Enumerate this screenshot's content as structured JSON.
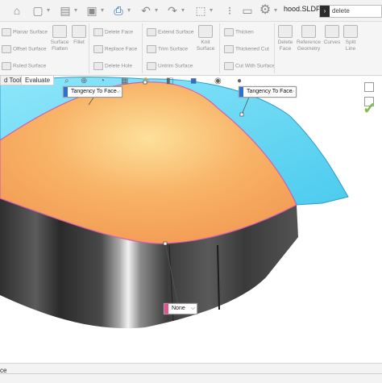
{
  "titlebar": {
    "document_title": "hood.SLDP...",
    "search_value": "delete",
    "icons": [
      "home-icon",
      "new-document-icon",
      "open-folder-icon",
      "save-icon",
      "print-icon",
      "undo-icon",
      "redo-icon",
      "select-icon",
      "traffic-light-icon",
      "options-gear-icon"
    ]
  },
  "ribbon": {
    "col1": [
      "Planar Surface",
      "Offset Surface",
      "Ruled Surface"
    ],
    "col1b": [
      "Surface Flatten"
    ],
    "col1c": [
      "Fillet"
    ],
    "col2": [
      "Delete Face",
      "Replace Face",
      "Delete Hole"
    ],
    "col3": [
      "Extend Surface",
      "Trim Surface",
      "Untrim Surface"
    ],
    "col3b": [
      "Knit Surface"
    ],
    "col4": [
      "Thicken",
      "Thickened Cut",
      "Cut With Surface"
    ],
    "col5": [
      "Delete Face",
      "Reference Geometry",
      "Curves",
      "Split Line"
    ]
  },
  "tabs": [
    "d Tools",
    "Evaluate"
  ],
  "callouts": {
    "left": "Tangency To Face",
    "right": "Tangency To Face",
    "bottom": "None"
  },
  "colors": {
    "orange_surface": "#f8b468",
    "cyan_surface": "#5fd6f3",
    "metal_dark": "#3b3b3b",
    "callout_blue": "#2f6fd1",
    "callout_pink": "#e6508c",
    "check_green": "#7bbf43"
  },
  "status": {
    "text": "ce"
  }
}
